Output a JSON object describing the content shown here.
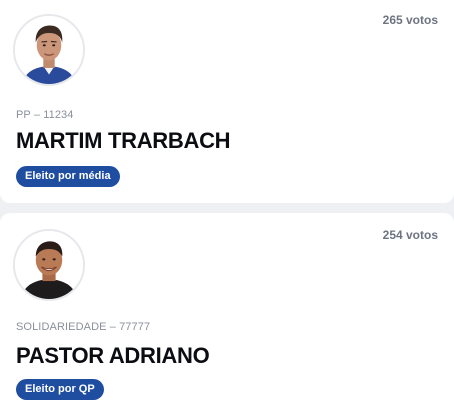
{
  "candidates": [
    {
      "votes": "265 votos",
      "party": "PP – 11234",
      "name": "MARTIM TRARBACH",
      "status": "Eleito por média",
      "photo_icon": "candidate-photo-man-dark-hair-blue-shirt"
    },
    {
      "votes": "254 votos",
      "party": "SOLIDARIEDADE – 77777",
      "name": "PASTOR ADRIANO",
      "status": "Eleito por QP",
      "photo_icon": "candidate-photo-man-smiling-dark-shirt"
    }
  ],
  "colors": {
    "badge": "#1f4ea1",
    "name": "#0b0d12",
    "secondary_text": "#8a909a",
    "background": "#eef0f3",
    "card": "#ffffff"
  }
}
